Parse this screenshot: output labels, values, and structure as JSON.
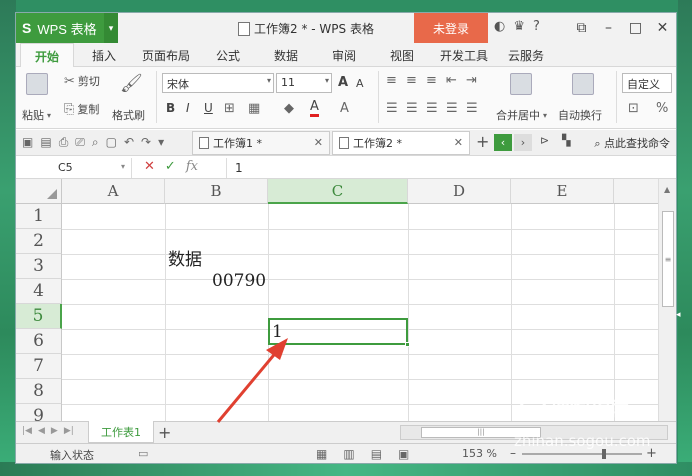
{
  "app": {
    "brand": "WPS 表格",
    "title": "工作簿2 * - WPS 表格",
    "login_label": "未登录",
    "help_label": "?"
  },
  "menu": {
    "tabs": [
      "开始",
      "插入",
      "页面布局",
      "公式",
      "数据",
      "审阅",
      "视图",
      "开发工具",
      "云服务"
    ]
  },
  "ribbon": {
    "paste": "粘贴",
    "cut": "剪切",
    "copy": "复制",
    "format_painter": "格式刷",
    "font_name": "宋体",
    "font_size": "11",
    "bold": "B",
    "italic": "I",
    "underline": "U",
    "merge_center": "合并居中",
    "wrap_text": "自动换行",
    "custom": "自定义",
    "percent": "%",
    "font_grow": "A",
    "font_color": "A"
  },
  "doc_tabs": {
    "tab1": "工作簿1 *",
    "tab2": "工作簿2 *",
    "add": "+",
    "find": "点此查找命令"
  },
  "formula_bar": {
    "name_box": "C5",
    "fx": "fx",
    "value": "1"
  },
  "grid": {
    "columns": [
      "A",
      "B",
      "C",
      "D",
      "E"
    ],
    "rows": [
      "1",
      "2",
      "3",
      "4",
      "5",
      "6",
      "7",
      "8",
      "9"
    ],
    "selected_col": "C",
    "selected_row": "5",
    "cells": {
      "B2": "数据",
      "B3": "00790",
      "C5": "1"
    }
  },
  "sheets": {
    "active": "工作表1",
    "add": "+"
  },
  "status": {
    "mode": "输入状态",
    "zoom": "153 %"
  },
  "watermark": {
    "brand": "搜狗指南",
    "url": "zhinan.sogou.com"
  },
  "colors": {
    "accent": "#3e9b3e",
    "login": "#e8694a",
    "arrow": "#e04030"
  }
}
